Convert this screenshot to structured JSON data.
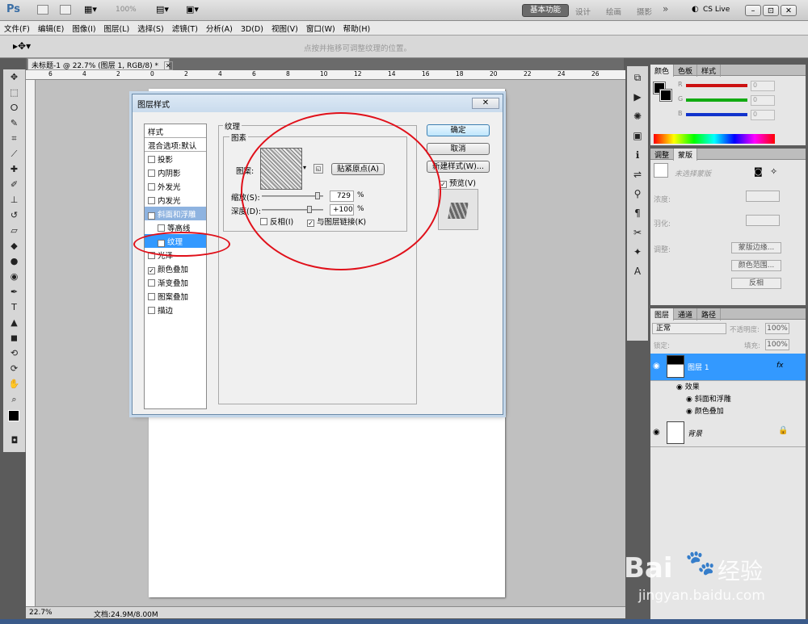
{
  "appbar": {
    "logo": "Ps",
    "zoom": "100%",
    "workspaces": [
      "基本功能",
      "设计",
      "绘画",
      "摄影"
    ],
    "more": "»",
    "cslive": "CS Live",
    "window_buttons": [
      "–",
      "⊡",
      "✕"
    ]
  },
  "menus": [
    "文件(F)",
    "编辑(E)",
    "图像(I)",
    "图层(L)",
    "选择(S)",
    "滤镜(T)",
    "分析(A)",
    "3D(D)",
    "视图(V)",
    "窗口(W)",
    "帮助(H)"
  ],
  "options": {
    "hint": "点按并拖移可调整纹理的位置。"
  },
  "document": {
    "tab_title": "未标题-1 @ 22.7% (图层 1, RGB/8) *",
    "tab_close": "✕",
    "ruler_top": [
      "6",
      "4",
      "2",
      "0",
      "2",
      "4",
      "6",
      "8",
      "10",
      "12",
      "14",
      "16",
      "18",
      "20",
      "22",
      "24",
      "26"
    ]
  },
  "status": {
    "zoom": "22.7%",
    "doc_info": "文档:24.9M/8.00M"
  },
  "dialog": {
    "title": "图层样式",
    "close": "✕",
    "styles_header": "样式",
    "blend_options": "混合选项:默认",
    "styles": [
      {
        "label": "投影",
        "checked": false
      },
      {
        "label": "内阴影",
        "checked": false
      },
      {
        "label": "外发光",
        "checked": false
      },
      {
        "label": "内发光",
        "checked": false
      },
      {
        "label": "斜面和浮雕",
        "checked": true
      },
      {
        "label": "等高线",
        "checked": false
      },
      {
        "label": "纹理",
        "checked": true
      },
      {
        "label": "光泽",
        "checked": false
      },
      {
        "label": "颜色叠加",
        "checked": true
      },
      {
        "label": "渐变叠加",
        "checked": false
      },
      {
        "label": "图案叠加",
        "checked": false
      },
      {
        "label": "描边",
        "checked": false
      }
    ],
    "group_title": "纹理",
    "sub_title": "图素",
    "pattern_label": "图案:",
    "snap_button": "贴紧原点(A)",
    "scale_label": "缩放(S):",
    "scale_value": "729",
    "scale_unit": "%",
    "depth_label": "深度(D):",
    "depth_value": "+100",
    "depth_unit": "%",
    "invert_label": "反相(I)",
    "invert_checked": false,
    "link_label": "与图层链接(K)",
    "link_checked": true,
    "ok": "确定",
    "cancel": "取消",
    "new_style": "新建样式(W)...",
    "preview_label": "预览(V)",
    "preview_checked": true
  },
  "color_panel": {
    "tabs": [
      "颜色",
      "色板",
      "样式"
    ],
    "channels": [
      {
        "name": "R",
        "value": "0",
        "color": "#cc1111"
      },
      {
        "name": "G",
        "value": "0",
        "color": "#11aa11"
      },
      {
        "name": "B",
        "value": "0",
        "color": "#1133cc"
      }
    ]
  },
  "adjust_panel": {
    "tabs": [
      "调整",
      "蒙版"
    ],
    "mask_title": "未选择蒙版",
    "density": "浓度:",
    "feather": "羽化:",
    "refine": "调整:",
    "btn_mask_edge": "蒙版边缘...",
    "btn_color_range": "颜色范围...",
    "btn_invert": "反相"
  },
  "layers_panel": {
    "tabs": [
      "图层",
      "通道",
      "路径"
    ],
    "blend_mode": "正常",
    "opacity_label": "不透明度:",
    "opacity": "100%",
    "lock_label": "锁定:",
    "fill_label": "填充:",
    "fill": "100%",
    "layers": [
      {
        "name": "图层 1",
        "fx": "fx"
      },
      {
        "name": "背景"
      }
    ],
    "effects_label": "效果",
    "effects": [
      "斜面和浮雕",
      "颜色叠加"
    ]
  },
  "watermark": {
    "brand": "Bai",
    "brand_cn": "经验",
    "url": "jingyan.baidu.com"
  }
}
